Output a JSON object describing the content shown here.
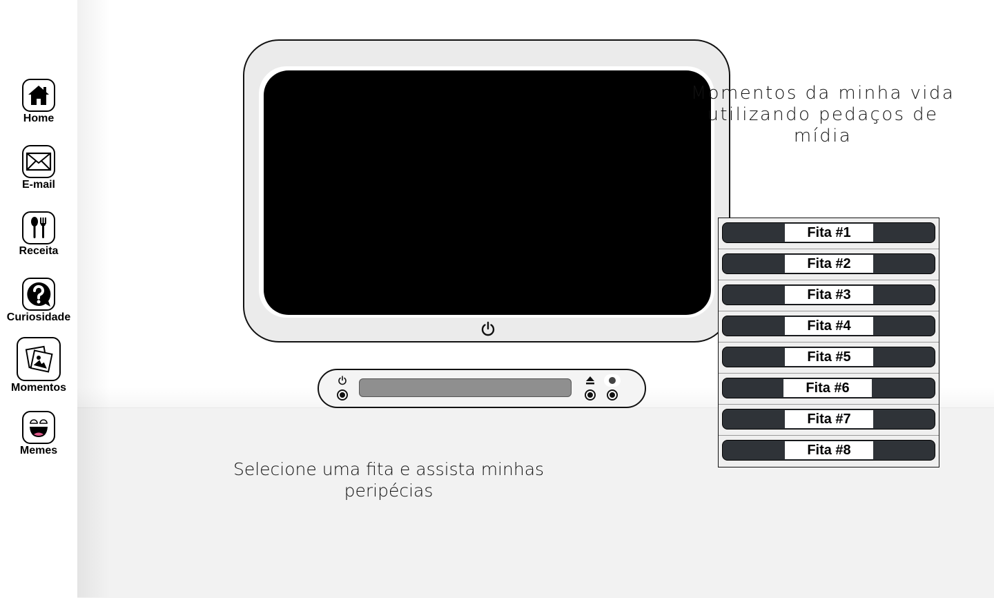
{
  "sidebar": {
    "items": [
      {
        "label": "Home",
        "icon": "home-icon"
      },
      {
        "label": "E-mail",
        "icon": "envelope-icon"
      },
      {
        "label": "Receita",
        "icon": "utensils-icon"
      },
      {
        "label": "Curiosidade",
        "icon": "question-icon"
      },
      {
        "label": "Momentos",
        "icon": "photos-icon"
      },
      {
        "label": "Memes",
        "icon": "laughing-face-icon"
      }
    ]
  },
  "main": {
    "headline_line1": "Momentos da minha vida",
    "headline_line2": "utilizando pedaços de mídia",
    "instruction": "Selecione uma fita e assista minhas peripécias",
    "tapes": [
      {
        "label": "Fita #1"
      },
      {
        "label": "Fita #2"
      },
      {
        "label": "Fita #3"
      },
      {
        "label": "Fita #4"
      },
      {
        "label": "Fita #5"
      },
      {
        "label": "Fita #6"
      },
      {
        "label": "Fita #7"
      },
      {
        "label": "Fita #8"
      }
    ]
  },
  "colors": {
    "screen": "#000000",
    "tv_body": "#ebebeb",
    "tape_shell": "#2f3338",
    "vcr_slot": "#8f8f8f",
    "floor": "#f2f2f2"
  }
}
